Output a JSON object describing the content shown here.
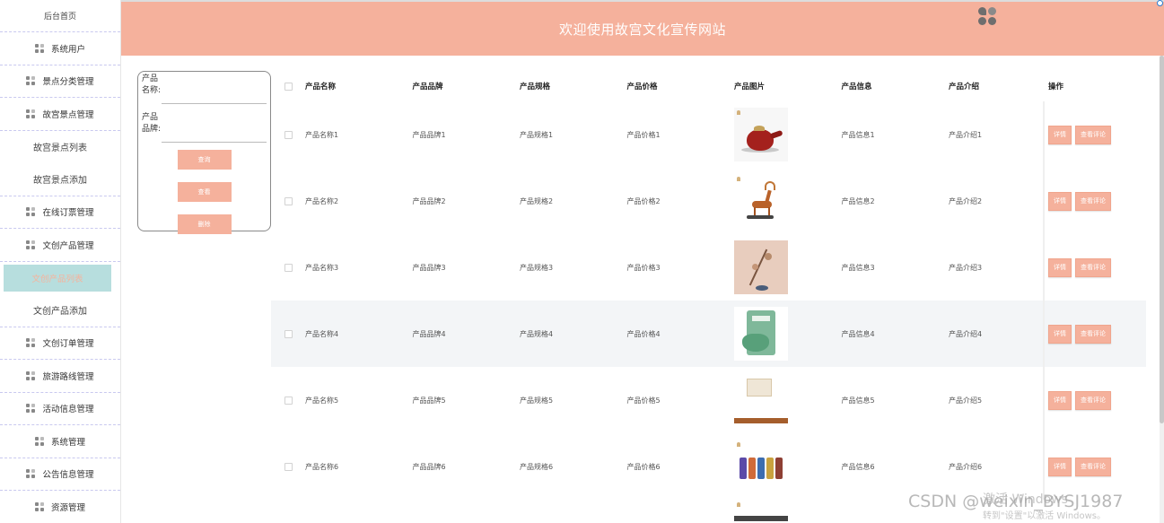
{
  "header": {
    "title": "欢迎使用故宫文化宣传网站"
  },
  "sidebar": {
    "home": "后台首页",
    "items": [
      {
        "label": "系统用户",
        "type": "group"
      },
      {
        "label": "景点分类管理",
        "type": "group"
      },
      {
        "label": "故宫景点管理",
        "type": "group"
      },
      {
        "label": "故宫景点列表",
        "type": "sub"
      },
      {
        "label": "故宫景点添加",
        "type": "sub"
      },
      {
        "label": "在线订票管理",
        "type": "group"
      },
      {
        "label": "文创产品管理",
        "type": "group"
      },
      {
        "label": "文创产品列表",
        "type": "sub-active"
      },
      {
        "label": "文创产品添加",
        "type": "sub"
      },
      {
        "label": "文创订单管理",
        "type": "group"
      },
      {
        "label": "旅游路线管理",
        "type": "group"
      },
      {
        "label": "活动信息管理",
        "type": "group"
      },
      {
        "label": "系统管理",
        "type": "group"
      },
      {
        "label": "公告信息管理",
        "type": "group"
      },
      {
        "label": "资源管理",
        "type": "group"
      }
    ]
  },
  "search": {
    "name_label": "产品名称:",
    "brand_label": "产品品牌:",
    "name_value": "",
    "brand_value": "",
    "query_btn": "查询",
    "view_btn": "查看",
    "delete_btn": "删除"
  },
  "table": {
    "headers": {
      "name": "产品名称",
      "brand": "产品品牌",
      "spec": "产品规格",
      "price": "产品价格",
      "image": "产品图片",
      "info": "产品信息",
      "intro": "产品介绍",
      "ops": "操作"
    },
    "rows": [
      {
        "name": "产品名称1",
        "brand": "产品品牌1",
        "spec": "产品规格1",
        "price": "产品价格1",
        "info": "产品信息1",
        "intro": "产品介绍1",
        "image": "teapot-image"
      },
      {
        "name": "产品名称2",
        "brand": "产品品牌2",
        "spec": "产品规格2",
        "price": "产品价格2",
        "info": "产品信息2",
        "intro": "产品介绍2",
        "image": "deer-image"
      },
      {
        "name": "产品名称3",
        "brand": "产品品牌3",
        "spec": "产品规格3",
        "price": "产品价格3",
        "info": "产品信息3",
        "intro": "产品介绍3",
        "image": "branch-image"
      },
      {
        "name": "产品名称4",
        "brand": "产品品牌4",
        "spec": "产品规格4",
        "price": "产品价格4",
        "info": "产品信息4",
        "intro": "产品介绍4",
        "image": "mask-image"
      },
      {
        "name": "产品名称5",
        "brand": "产品品牌5",
        "spec": "产品规格5",
        "price": "产品价格5",
        "info": "产品信息5",
        "intro": "产品介绍5",
        "image": "paper-image"
      },
      {
        "name": "产品名称6",
        "brand": "产品品牌6",
        "spec": "产品规格6",
        "price": "产品价格6",
        "info": "产品信息6",
        "intro": "产品介绍6",
        "image": "scarf-image"
      }
    ],
    "detail_btn": "详情",
    "review_btn": "查看评论"
  },
  "watermark": {
    "windows_line1": "激活 Windows",
    "windows_line2": "转到\"设置\"以激活 Windows。",
    "csdn": "CSDN @weixin_BYSJ1987"
  },
  "colors": {
    "accent": "#f5b19c",
    "active_bg": "#b7dede",
    "highlight_row": "#f3f5f7"
  }
}
